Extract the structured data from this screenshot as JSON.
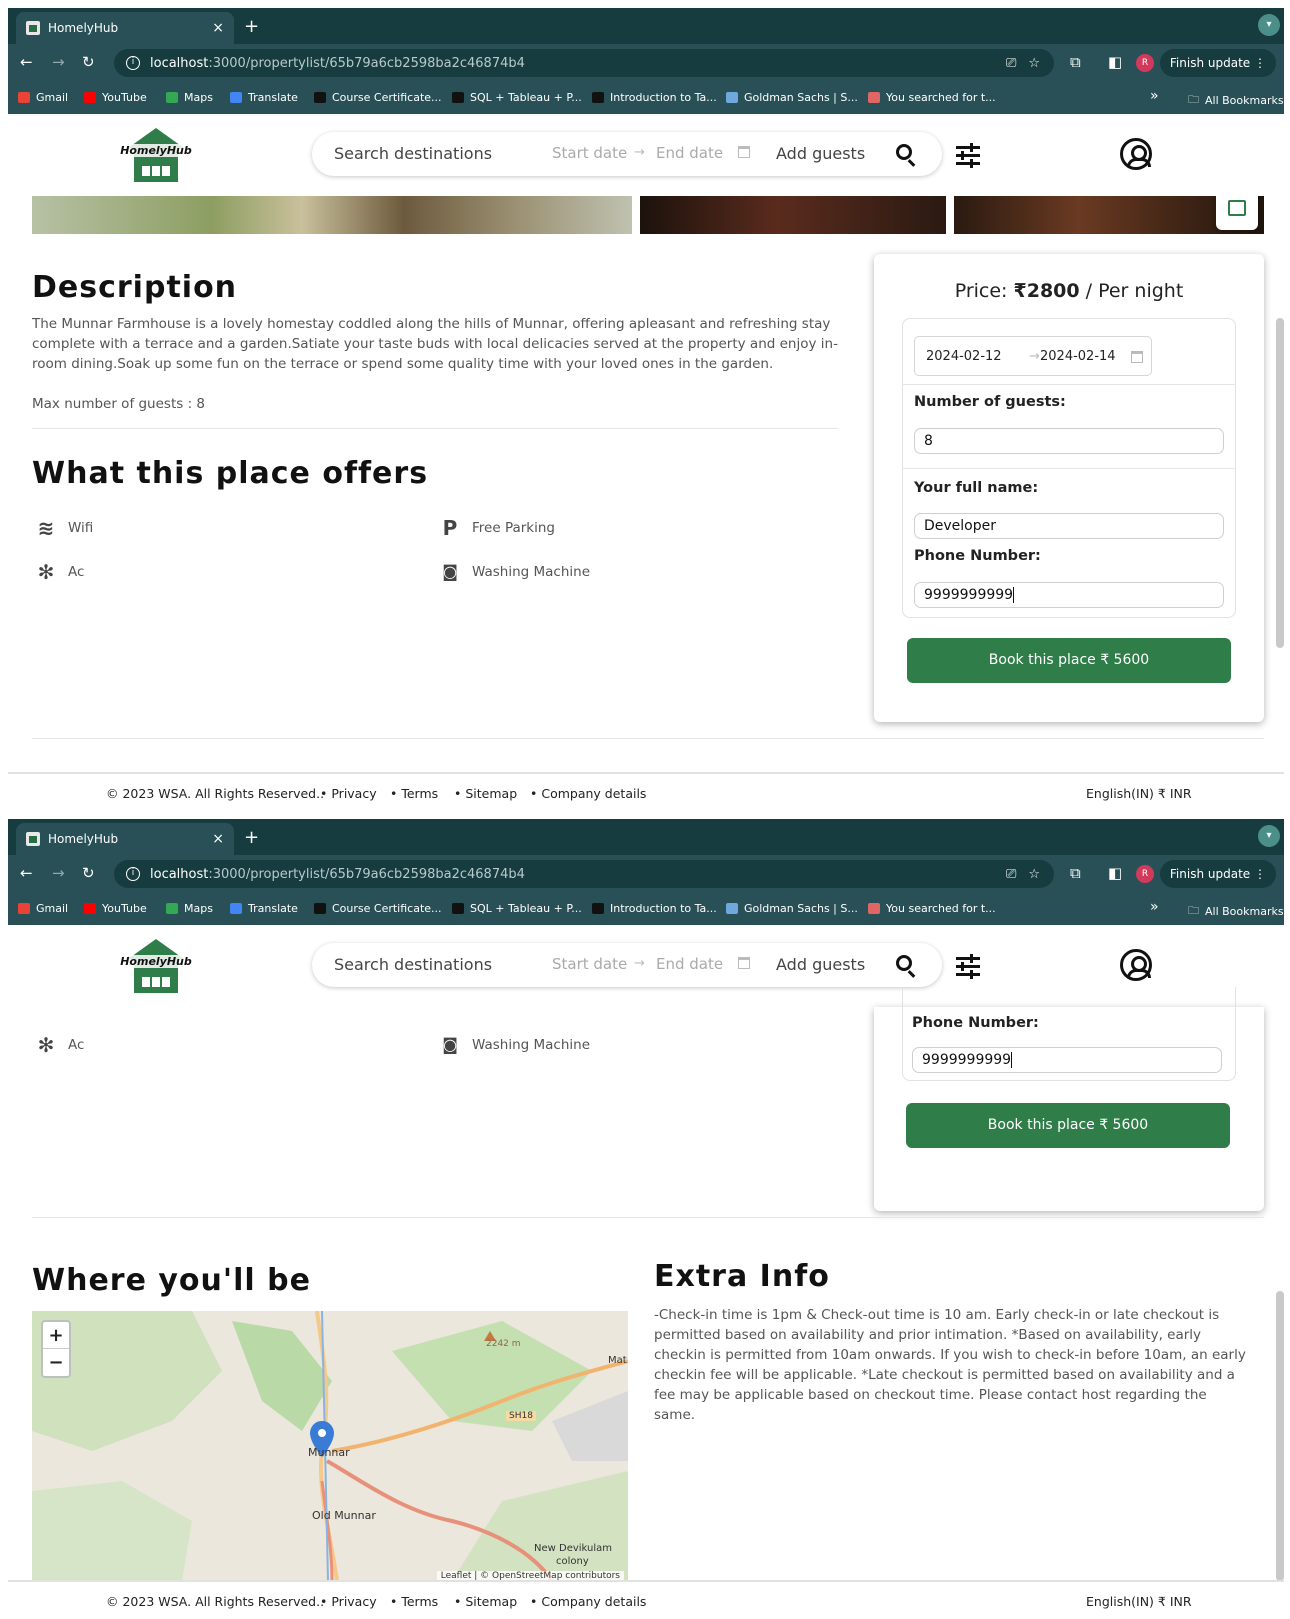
{
  "browser": {
    "tab_title": "HomelyHub",
    "tab_close": "×",
    "new_tab": "+",
    "url_host": "localhost",
    "url_path": ":3000/propertylist/65b79a6cb2598ba2c46874b4",
    "profile_initial": "R",
    "finish_update": "Finish update",
    "more_bookmarks": "»",
    "all_bookmarks": "All Bookmarks",
    "bookmarks": [
      {
        "label": "Gmail",
        "color": "#ea4335"
      },
      {
        "label": "YouTube",
        "color": "#ff0000"
      },
      {
        "label": "Maps",
        "color": "#34a853"
      },
      {
        "label": "Translate",
        "color": "#4285f4"
      },
      {
        "label": "Course Certificate...",
        "color": "#111111"
      },
      {
        "label": "SQL + Tableau + P...",
        "color": "#111111"
      },
      {
        "label": "Introduction to Ta...",
        "color": "#111111"
      },
      {
        "label": "Goldman Sachs | S...",
        "color": "#6fa8dc"
      },
      {
        "label": "You searched for t...",
        "color": "#e06666"
      }
    ]
  },
  "header": {
    "logo_text": "HomelyHub",
    "search_placeholder": "Search destinations",
    "start_date": "Start date",
    "arrow": "→",
    "end_date": "End date",
    "add_guests": "Add guests"
  },
  "description": {
    "title": "Description",
    "text": "The Munnar Farmhouse is a lovely homestay coddled along the hills of Munnar, offering apleasant and refreshing stay complete with a terrace and a garden.Satiate your taste buds with local delicacies served at the property and enjoy in-room dining.Soak up some fun on the terrace or spend some quality time with your loved ones in the garden.",
    "max_guests": "Max number of guests : 8"
  },
  "offers": {
    "title": "What this place offers",
    "items": [
      {
        "label": "Wifi",
        "icon": "wifi-icon"
      },
      {
        "label": "Free Parking",
        "icon": "parking-icon"
      },
      {
        "label": "Ac",
        "icon": "snowflake-icon"
      },
      {
        "label": "Washing Machine",
        "icon": "washing-machine-icon"
      }
    ]
  },
  "booking": {
    "price_prefix": "Price: ",
    "price_value": "₹2800",
    "price_suffix": " / Per night",
    "check_in": "2024-02-12",
    "arrow": "→",
    "check_out": "2024-02-14",
    "guests_label": "Number of guests:",
    "guests_value": "8",
    "name_label": "Your full name:",
    "name_value": "Developer",
    "phone_label": "Phone Number:",
    "phone_value": "9999999999",
    "book_button": "Book this place ₹ 5600"
  },
  "location": {
    "title": "Where you'll be",
    "zoom_in": "+",
    "zoom_out": "−",
    "places": [
      "Munnar",
      "Old Munnar",
      "New Devikulam",
      "colony",
      "SH18",
      "2242 m",
      "Mat"
    ],
    "attribution": "Leaflet | © OpenStreetMap contributors"
  },
  "extra": {
    "title": "Extra Info",
    "text": "-Check-in time is 1pm & Check-out time is 10 am. Early check-in or late checkout is permitted based on availability and prior intimation. *Based on availability, early checkin is permitted from 10am onwards. If you wish to check-in before 10am, an early checkin fee will be applicable. *Late checkout is permitted based on availability and a fee may be applicable based on checkout time. Please contact host regarding the same."
  },
  "footer": {
    "copyright": "© 2023 WSA. All Rights Reserved..",
    "links": [
      "Privacy",
      "Terms",
      "Sitemap",
      "Company details"
    ],
    "locale": "English(IN) ₹ INR"
  },
  "colors": {
    "brand_green": "#2f7d48",
    "chrome_dark": "#173c3f",
    "chrome": "#285056"
  }
}
